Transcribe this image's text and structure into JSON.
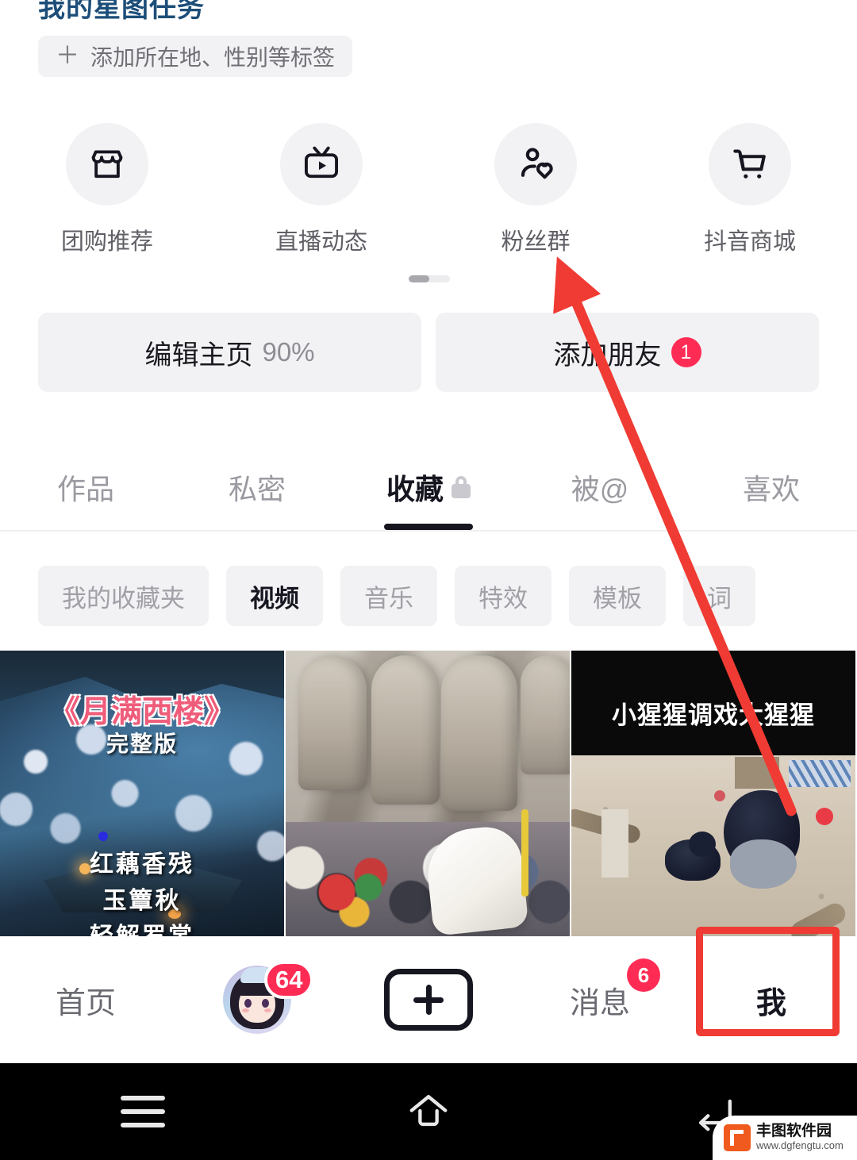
{
  "star_task": {
    "title": "我的星图任务"
  },
  "tag_button": {
    "plus": "＋",
    "label": "添加所在地、性别等标签"
  },
  "entries": [
    {
      "label": "团购推荐",
      "icon": "store-icon"
    },
    {
      "label": "直播动态",
      "icon": "live-tv-icon"
    },
    {
      "label": "粉丝群",
      "icon": "fans-group-icon"
    },
    {
      "label": "抖音商城",
      "icon": "shopping-cart-icon"
    }
  ],
  "actions": {
    "edit_profile": {
      "label": "编辑主页",
      "progress": "90%"
    },
    "add_friend": {
      "label": "添加朋友",
      "badge": "1"
    }
  },
  "tabs": [
    {
      "label": "作品",
      "active": false,
      "lock": false
    },
    {
      "label": "私密",
      "active": false,
      "lock": false
    },
    {
      "label": "收藏",
      "active": true,
      "lock": true
    },
    {
      "label": "被@",
      "active": false,
      "lock": false
    },
    {
      "label": "喜欢",
      "active": false,
      "lock": false
    }
  ],
  "chips": [
    {
      "label": "我的收藏夹",
      "active": false
    },
    {
      "label": "视频",
      "active": true
    },
    {
      "label": "音乐",
      "active": false
    },
    {
      "label": "特效",
      "active": false
    },
    {
      "label": "模板",
      "active": false
    },
    {
      "label": "词",
      "active": false
    }
  ],
  "thumbnails": [
    {
      "name": "moonlit-tower-video",
      "title": "《月满西楼》",
      "subtitle": "完整版",
      "line1": "红藕香残",
      "line2": "玉簟秋",
      "line3": "轻解罗裳"
    },
    {
      "name": "grotto-crowd-video",
      "caption": ""
    },
    {
      "name": "gorilla-video",
      "caption": "小猩猩调戏大猩猩"
    }
  ],
  "bottom_nav": [
    {
      "label": "首页",
      "active": false,
      "type": "text"
    },
    {
      "label": "",
      "active": false,
      "type": "avatar",
      "badge": "64"
    },
    {
      "label": "",
      "active": false,
      "type": "plus"
    },
    {
      "label": "消息",
      "active": false,
      "type": "text",
      "badge": "6"
    },
    {
      "label": "我",
      "active": true,
      "type": "text"
    }
  ],
  "system_nav": [
    {
      "icon": "recents-menu-icon"
    },
    {
      "icon": "home-icon"
    },
    {
      "icon": "back-icon"
    }
  ],
  "watermark": {
    "name": "丰图软件园",
    "url": "www.dgfengtu.com"
  },
  "colors": {
    "accent_red": "#fe2c55",
    "annotation_red": "#ef3b33",
    "title_blue": "#1d4e79",
    "chip_bg": "#f2f2f4",
    "active_text": "#161620",
    "muted_text": "#9a9aa1"
  }
}
